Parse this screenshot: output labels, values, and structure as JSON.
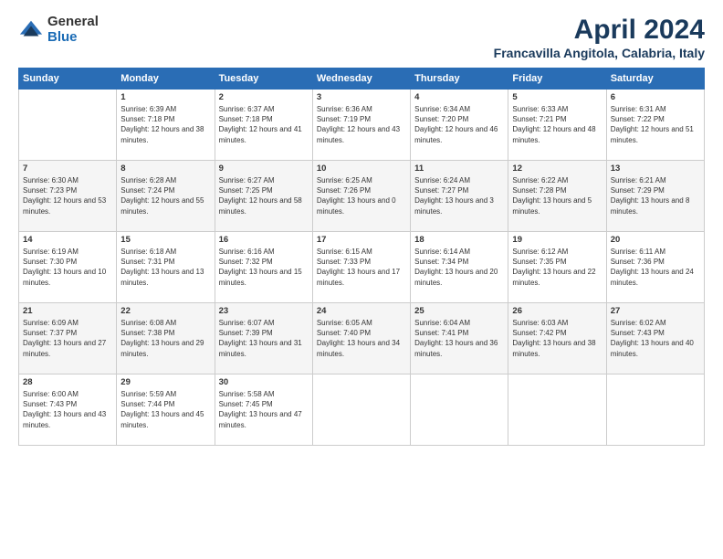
{
  "logo": {
    "general": "General",
    "blue": "Blue"
  },
  "title": "April 2024",
  "subtitle": "Francavilla Angitola, Calabria, Italy",
  "weekdays": [
    "Sunday",
    "Monday",
    "Tuesday",
    "Wednesday",
    "Thursday",
    "Friday",
    "Saturday"
  ],
  "weeks": [
    [
      {
        "day": "",
        "sunrise": "",
        "sunset": "",
        "daylight": ""
      },
      {
        "day": "1",
        "sunrise": "Sunrise: 6:39 AM",
        "sunset": "Sunset: 7:18 PM",
        "daylight": "Daylight: 12 hours and 38 minutes."
      },
      {
        "day": "2",
        "sunrise": "Sunrise: 6:37 AM",
        "sunset": "Sunset: 7:18 PM",
        "daylight": "Daylight: 12 hours and 41 minutes."
      },
      {
        "day": "3",
        "sunrise": "Sunrise: 6:36 AM",
        "sunset": "Sunset: 7:19 PM",
        "daylight": "Daylight: 12 hours and 43 minutes."
      },
      {
        "day": "4",
        "sunrise": "Sunrise: 6:34 AM",
        "sunset": "Sunset: 7:20 PM",
        "daylight": "Daylight: 12 hours and 46 minutes."
      },
      {
        "day": "5",
        "sunrise": "Sunrise: 6:33 AM",
        "sunset": "Sunset: 7:21 PM",
        "daylight": "Daylight: 12 hours and 48 minutes."
      },
      {
        "day": "6",
        "sunrise": "Sunrise: 6:31 AM",
        "sunset": "Sunset: 7:22 PM",
        "daylight": "Daylight: 12 hours and 51 minutes."
      }
    ],
    [
      {
        "day": "7",
        "sunrise": "Sunrise: 6:30 AM",
        "sunset": "Sunset: 7:23 PM",
        "daylight": "Daylight: 12 hours and 53 minutes."
      },
      {
        "day": "8",
        "sunrise": "Sunrise: 6:28 AM",
        "sunset": "Sunset: 7:24 PM",
        "daylight": "Daylight: 12 hours and 55 minutes."
      },
      {
        "day": "9",
        "sunrise": "Sunrise: 6:27 AM",
        "sunset": "Sunset: 7:25 PM",
        "daylight": "Daylight: 12 hours and 58 minutes."
      },
      {
        "day": "10",
        "sunrise": "Sunrise: 6:25 AM",
        "sunset": "Sunset: 7:26 PM",
        "daylight": "Daylight: 13 hours and 0 minutes."
      },
      {
        "day": "11",
        "sunrise": "Sunrise: 6:24 AM",
        "sunset": "Sunset: 7:27 PM",
        "daylight": "Daylight: 13 hours and 3 minutes."
      },
      {
        "day": "12",
        "sunrise": "Sunrise: 6:22 AM",
        "sunset": "Sunset: 7:28 PM",
        "daylight": "Daylight: 13 hours and 5 minutes."
      },
      {
        "day": "13",
        "sunrise": "Sunrise: 6:21 AM",
        "sunset": "Sunset: 7:29 PM",
        "daylight": "Daylight: 13 hours and 8 minutes."
      }
    ],
    [
      {
        "day": "14",
        "sunrise": "Sunrise: 6:19 AM",
        "sunset": "Sunset: 7:30 PM",
        "daylight": "Daylight: 13 hours and 10 minutes."
      },
      {
        "day": "15",
        "sunrise": "Sunrise: 6:18 AM",
        "sunset": "Sunset: 7:31 PM",
        "daylight": "Daylight: 13 hours and 13 minutes."
      },
      {
        "day": "16",
        "sunrise": "Sunrise: 6:16 AM",
        "sunset": "Sunset: 7:32 PM",
        "daylight": "Daylight: 13 hours and 15 minutes."
      },
      {
        "day": "17",
        "sunrise": "Sunrise: 6:15 AM",
        "sunset": "Sunset: 7:33 PM",
        "daylight": "Daylight: 13 hours and 17 minutes."
      },
      {
        "day": "18",
        "sunrise": "Sunrise: 6:14 AM",
        "sunset": "Sunset: 7:34 PM",
        "daylight": "Daylight: 13 hours and 20 minutes."
      },
      {
        "day": "19",
        "sunrise": "Sunrise: 6:12 AM",
        "sunset": "Sunset: 7:35 PM",
        "daylight": "Daylight: 13 hours and 22 minutes."
      },
      {
        "day": "20",
        "sunrise": "Sunrise: 6:11 AM",
        "sunset": "Sunset: 7:36 PM",
        "daylight": "Daylight: 13 hours and 24 minutes."
      }
    ],
    [
      {
        "day": "21",
        "sunrise": "Sunrise: 6:09 AM",
        "sunset": "Sunset: 7:37 PM",
        "daylight": "Daylight: 13 hours and 27 minutes."
      },
      {
        "day": "22",
        "sunrise": "Sunrise: 6:08 AM",
        "sunset": "Sunset: 7:38 PM",
        "daylight": "Daylight: 13 hours and 29 minutes."
      },
      {
        "day": "23",
        "sunrise": "Sunrise: 6:07 AM",
        "sunset": "Sunset: 7:39 PM",
        "daylight": "Daylight: 13 hours and 31 minutes."
      },
      {
        "day": "24",
        "sunrise": "Sunrise: 6:05 AM",
        "sunset": "Sunset: 7:40 PM",
        "daylight": "Daylight: 13 hours and 34 minutes."
      },
      {
        "day": "25",
        "sunrise": "Sunrise: 6:04 AM",
        "sunset": "Sunset: 7:41 PM",
        "daylight": "Daylight: 13 hours and 36 minutes."
      },
      {
        "day": "26",
        "sunrise": "Sunrise: 6:03 AM",
        "sunset": "Sunset: 7:42 PM",
        "daylight": "Daylight: 13 hours and 38 minutes."
      },
      {
        "day": "27",
        "sunrise": "Sunrise: 6:02 AM",
        "sunset": "Sunset: 7:43 PM",
        "daylight": "Daylight: 13 hours and 40 minutes."
      }
    ],
    [
      {
        "day": "28",
        "sunrise": "Sunrise: 6:00 AM",
        "sunset": "Sunset: 7:43 PM",
        "daylight": "Daylight: 13 hours and 43 minutes."
      },
      {
        "day": "29",
        "sunrise": "Sunrise: 5:59 AM",
        "sunset": "Sunset: 7:44 PM",
        "daylight": "Daylight: 13 hours and 45 minutes."
      },
      {
        "day": "30",
        "sunrise": "Sunrise: 5:58 AM",
        "sunset": "Sunset: 7:45 PM",
        "daylight": "Daylight: 13 hours and 47 minutes."
      },
      {
        "day": "",
        "sunrise": "",
        "sunset": "",
        "daylight": ""
      },
      {
        "day": "",
        "sunrise": "",
        "sunset": "",
        "daylight": ""
      },
      {
        "day": "",
        "sunrise": "",
        "sunset": "",
        "daylight": ""
      },
      {
        "day": "",
        "sunrise": "",
        "sunset": "",
        "daylight": ""
      }
    ]
  ]
}
